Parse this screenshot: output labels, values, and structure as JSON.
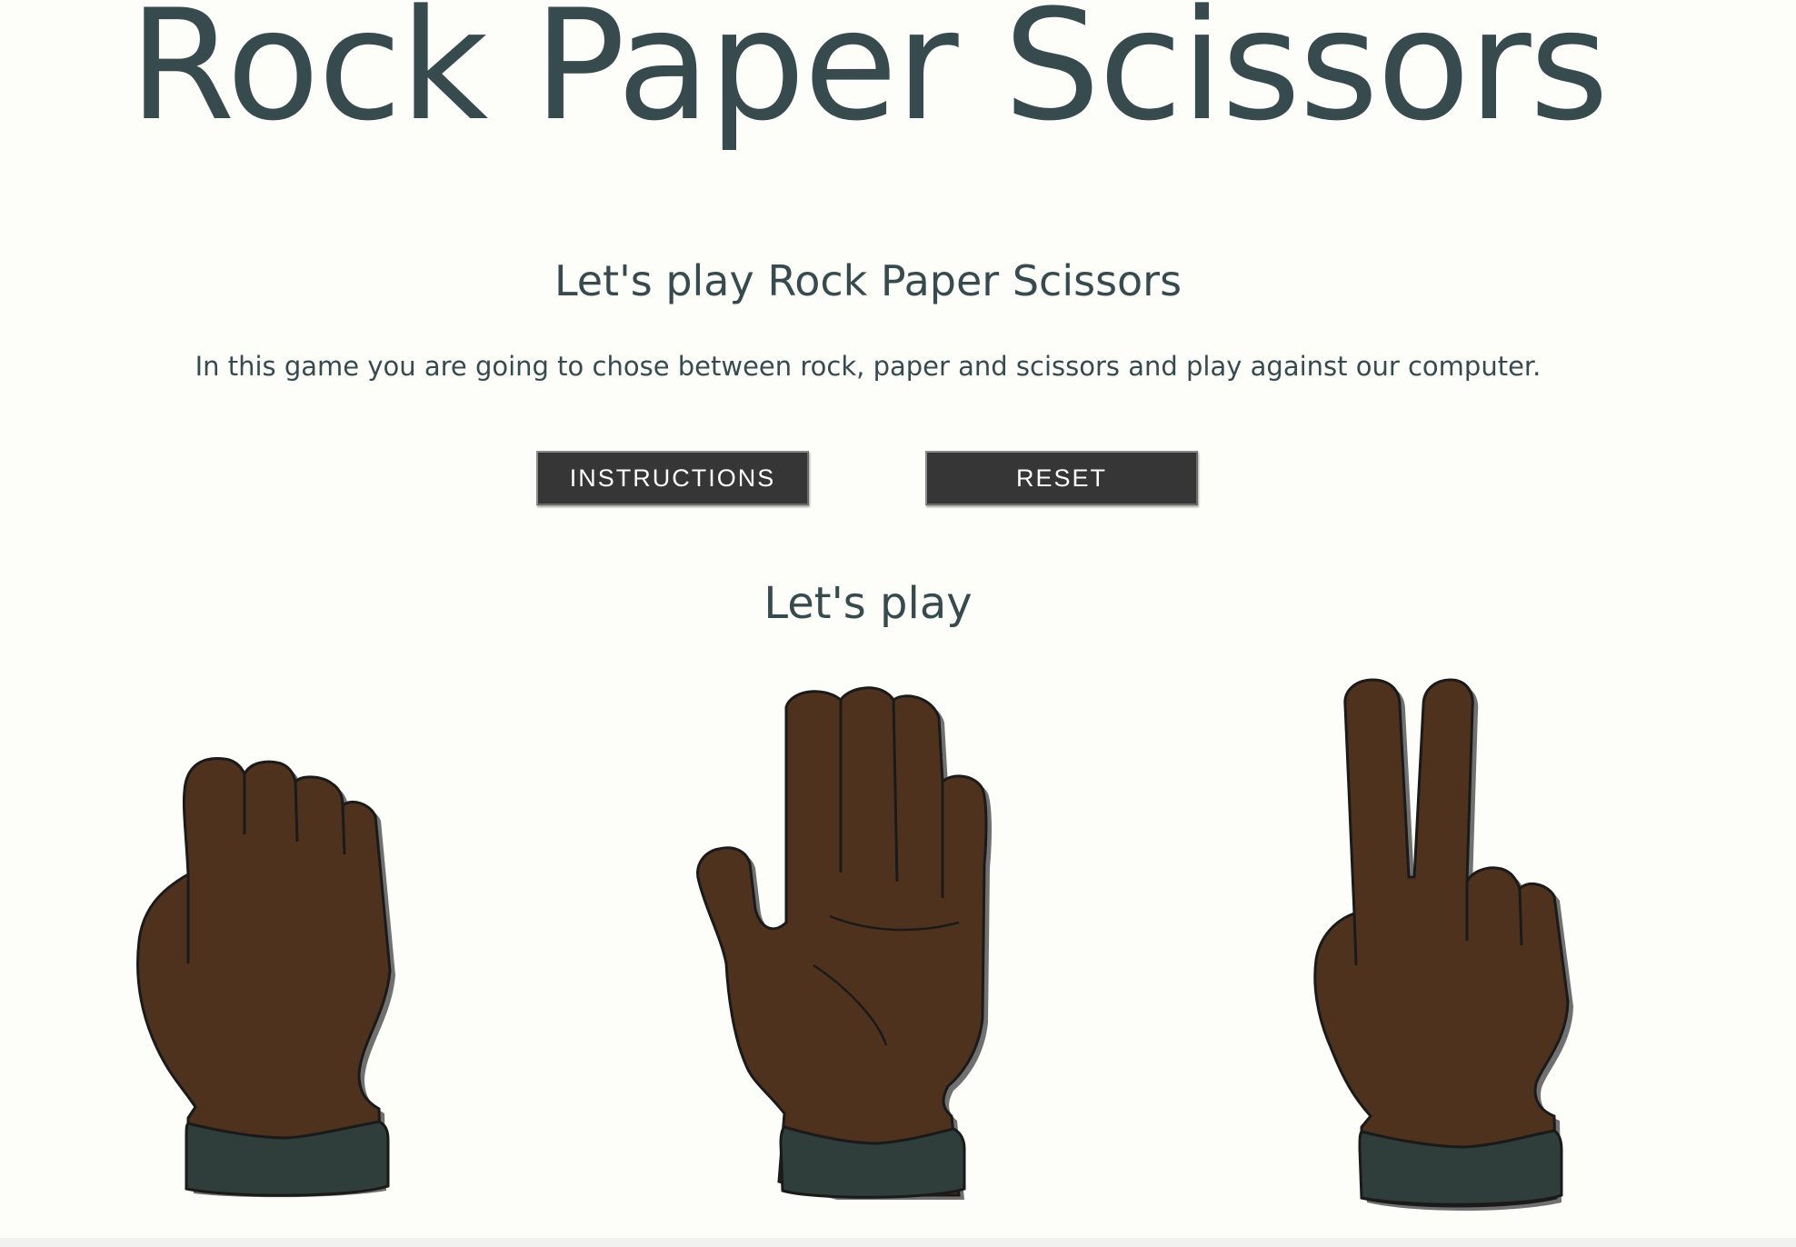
{
  "header": {
    "title": "Rock Paper Scissors"
  },
  "intro": {
    "heading": "Let's play Rock Paper Scissors",
    "description": "In this game you are going to chose between rock, paper and scissors and play against our computer."
  },
  "controls": {
    "instructions_label": "INSTRUCTIONS",
    "reset_label": "RESET"
  },
  "game": {
    "heading": "Let's play",
    "choices": [
      {
        "id": "rock",
        "icon": "rock-fist-icon"
      },
      {
        "id": "paper",
        "icon": "paper-open-hand-icon"
      },
      {
        "id": "scissors",
        "icon": "scissors-two-fingers-icon"
      }
    ]
  },
  "colors": {
    "background": "#fdfdfa",
    "text": "#374b4f",
    "button": "#363636",
    "skin": "#4f321e",
    "sleeve": "#2f3e3a"
  }
}
